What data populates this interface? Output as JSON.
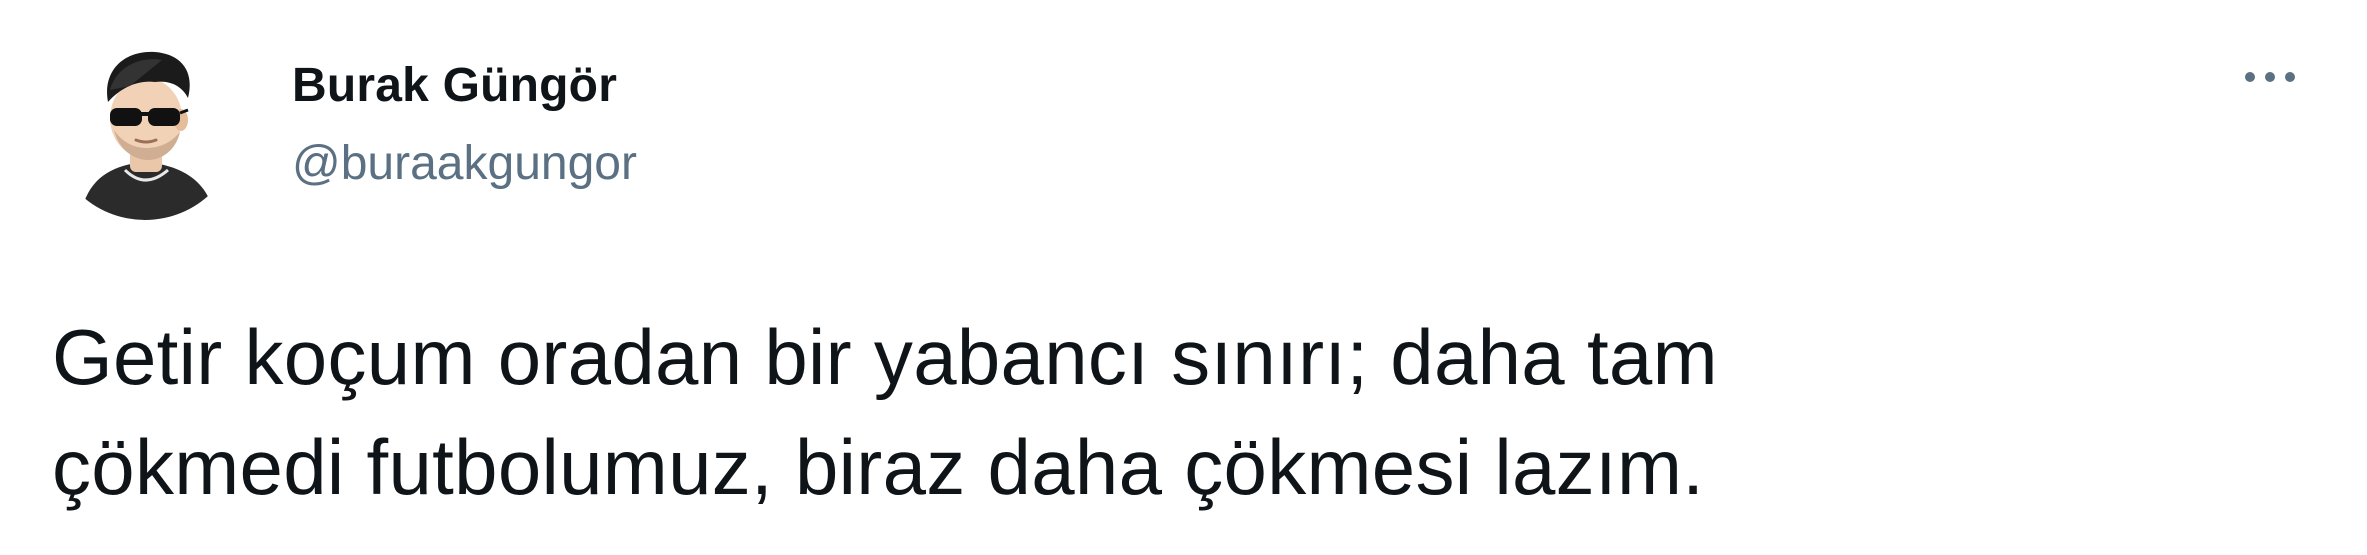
{
  "author": {
    "display_name": "Burak Güngör",
    "handle": "@buraakgungor",
    "avatar_icon": "cartoon-man-sunglasses-avatar"
  },
  "tweet": {
    "lines": [
      "Getir koçum oradan bir yabancı sınırı; daha tam",
      "çökmedi futbolumuz, biraz daha çökmesi lazım."
    ]
  },
  "actions": {
    "more_icon": "more-horizontal-icon"
  },
  "colors": {
    "text": "#0f1419",
    "secondary": "#5b7083"
  }
}
